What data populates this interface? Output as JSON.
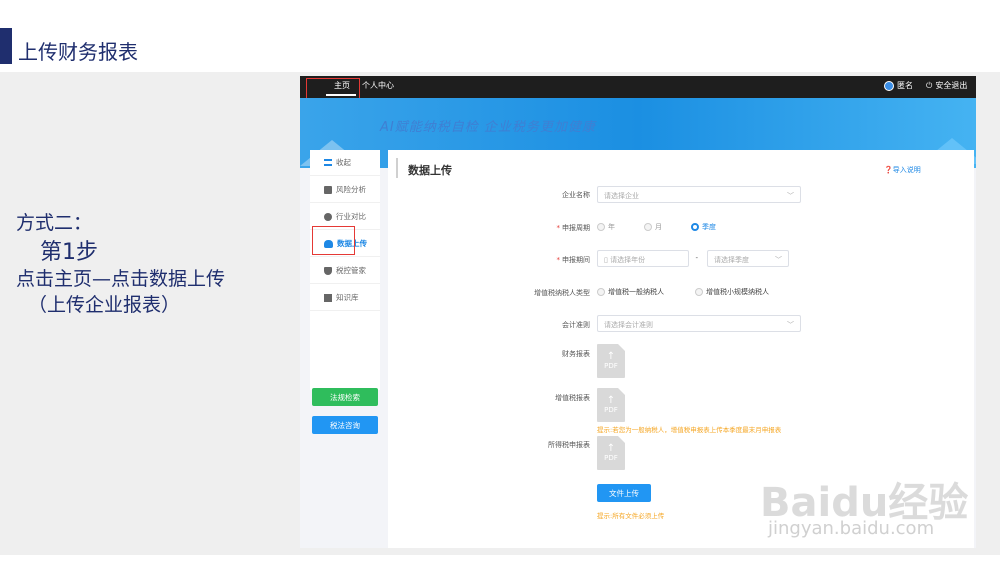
{
  "slide": {
    "title": "上传财务报表",
    "lines": [
      "方式二：",
      "第1步",
      "点击主页—点击数据上传",
      "（上传企业报表）"
    ]
  },
  "topbar": {
    "home": "主页",
    "personal": "个人中心",
    "anonymous": "匿名",
    "logout": "安全退出"
  },
  "banner": {
    "slogan": "AI赋能纳税自检    企业税务更加健康"
  },
  "sidebar": {
    "items": [
      {
        "label": "收起",
        "icon": "menu-icon"
      },
      {
        "label": "风险分析",
        "icon": "risk-icon"
      },
      {
        "label": "行业对比",
        "icon": "pie-icon"
      },
      {
        "label": "数据上传",
        "icon": "cloud-upload-icon"
      },
      {
        "label": "税控管家",
        "icon": "shield-icon"
      },
      {
        "label": "知识库",
        "icon": "book-icon"
      }
    ],
    "btn_regulation": "法规检索",
    "btn_consult": "税法咨询"
  },
  "card": {
    "title": "数据上传",
    "import_help": "❓导入说明",
    "company_label": "企业名称",
    "company_placeholder": "请选择企业",
    "period_type_label": "申报周期",
    "period_options": [
      "年",
      "月",
      "季度"
    ],
    "period_label": "申报期间",
    "year_placeholder": "请选择年份",
    "quarter_placeholder": "请选择季度",
    "taxpayer_type_label": "增值税纳税人类型",
    "taxpayer_options": [
      "增值税一般纳税人",
      "增值税小规模纳税人"
    ],
    "accounting_label": "会计准则",
    "accounting_placeholder": "请选择会计准则",
    "financial_report_label": "财务报表",
    "vat_report_label": "增值税报表",
    "income_tax_label": "所得税申报表",
    "pdf_text": "PDF",
    "vat_hint": "提示:若您为一般纳税人，增值税申报表上传本季度最末月申报表",
    "upload_button": "文件上传",
    "upload_hint": "提示:所有文件必须上传"
  },
  "watermark": {
    "brand": "Baidu经验",
    "url": "jingyan.baidu.com"
  },
  "colors": {
    "accent": "#1e88e5",
    "navy": "#1f2e6e",
    "highlight": "#e53935",
    "green": "#2fbd5c"
  }
}
